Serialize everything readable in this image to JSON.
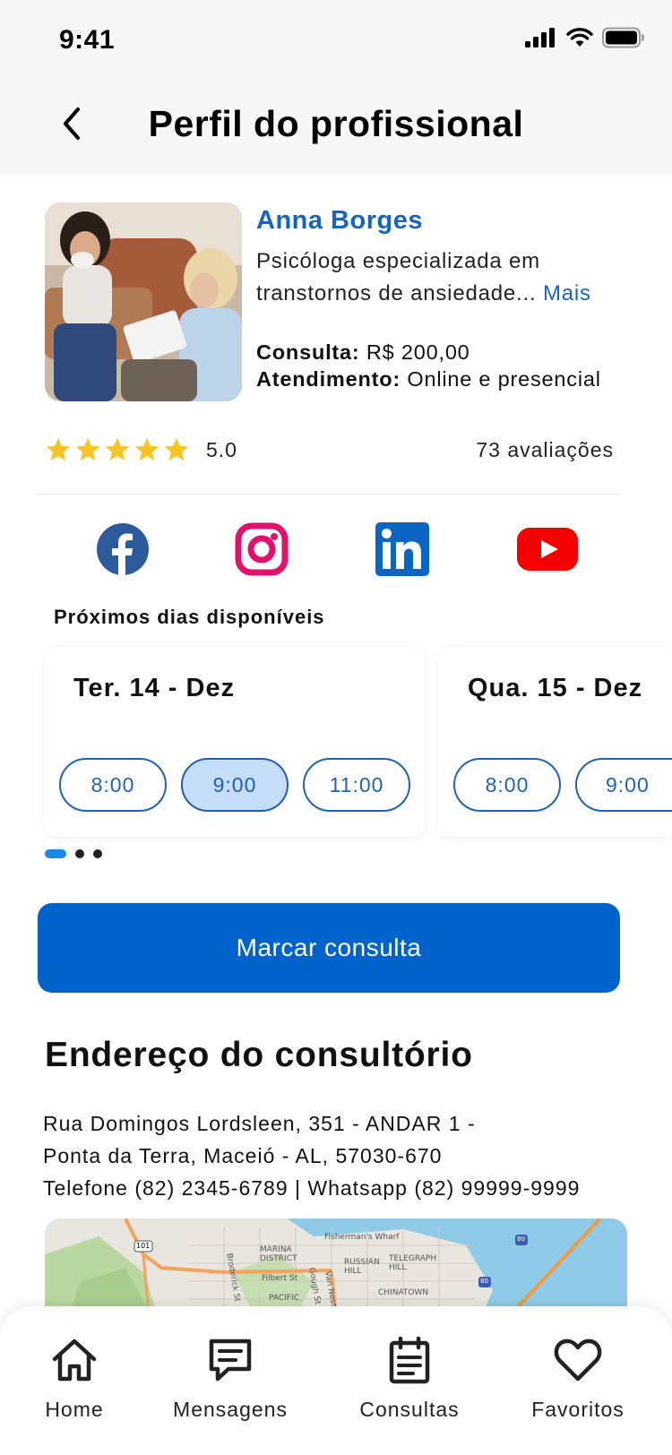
{
  "status_bar": {
    "time": "9:41"
  },
  "header": {
    "title": "Perfil do profissional"
  },
  "profile": {
    "name": "Anna Borges",
    "bio": "Psicóloga especializada em transtornos de ansiedade...",
    "bio_more": "Mais",
    "consulta_label": "Consulta:",
    "consulta_value": "R$ 200,00",
    "atendimento_label": "Atendimento:",
    "atendimento_value": "Online e presencial"
  },
  "rating": {
    "stars": 5,
    "value": "5.0",
    "reviews": "73 avaliações"
  },
  "social": {
    "icons": [
      "facebook-icon",
      "instagram-icon",
      "linkedin-icon",
      "youtube-icon"
    ]
  },
  "availability": {
    "title": "Próximos dias disponíveis",
    "days": [
      {
        "label": "Ter. 14 - Dez",
        "slots": [
          "8:00",
          "9:00",
          "11:00"
        ],
        "selected": "9:00"
      },
      {
        "label": "Qua. 15 - Dez",
        "slots": [
          "8:00",
          "9:00"
        ]
      }
    ],
    "pager": {
      "pages": 3,
      "active": 1
    }
  },
  "book_button": "Marcar consulta",
  "address": {
    "title": "Endereço do consultório",
    "line1": "Rua Domingos Lordsleen, 351 - ANDAR 1 -",
    "line2": "Ponta da Terra, Maceió - AL, 57030-670",
    "line3": "Telefone (82) 2345-6789 | Whatsapp (82) 99999-9999"
  },
  "map": {
    "labels": [
      "Fisherman's Wharf",
      "MARINA DISTRICT",
      "RUSSIAN HILL",
      "TELEGRAPH HILL",
      "Filbert St",
      "PACIFIC",
      "CHINATOWN",
      "Broderick St",
      "Gough St",
      "Van Ness Ave"
    ],
    "shields": [
      "101",
      "80",
      "80"
    ]
  },
  "nav": {
    "home": "Home",
    "mensagens": "Mensagens",
    "consultas": "Consultas",
    "favoritos": "Favoritos"
  },
  "colors": {
    "accent": "#1565c0",
    "button": "#0063cc",
    "star": "#f7c325",
    "selected_slot_bg": "#c6defa"
  }
}
